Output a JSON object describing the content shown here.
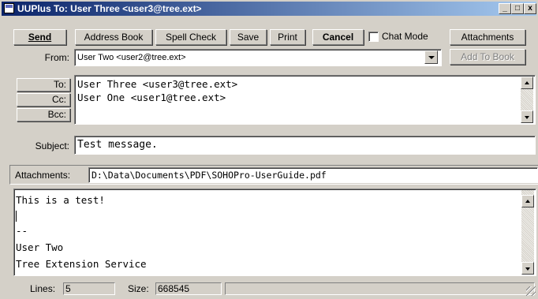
{
  "window": {
    "title": "UUPlus To: User Three <user3@tree.ext>",
    "controls": {
      "minimize": "_",
      "maximize": "□",
      "close": "x"
    }
  },
  "toolbar": {
    "send_label": "Send",
    "address_book_label": "Address Book",
    "spell_check_label": "Spell Check",
    "save_label": "Save",
    "print_label": "Print",
    "cancel_label": "Cancel",
    "chat_mode_label": "Chat Mode",
    "chat_mode_checked": false,
    "attachments_label": "Attachments"
  },
  "from": {
    "label": "From:",
    "value": "User Two <user2@tree.ext>",
    "add_to_book_label": "Add To Book"
  },
  "recipients": {
    "to_label": "To:",
    "cc_label": "Cc:",
    "bcc_label": "Bcc:",
    "lines": [
      "User Three <user3@tree.ext>",
      "User One <user1@tree.ext>"
    ]
  },
  "subject": {
    "label": "Subject:",
    "value": "Test message."
  },
  "attachments": {
    "label": "Attachments:",
    "value": "D:\\Data\\Documents\\PDF\\SOHOPro-UserGuide.pdf"
  },
  "body": {
    "lines": [
      "This is a test!",
      "",
      "--",
      "User Two",
      "Tree Extension Service"
    ]
  },
  "statusbar": {
    "lines_label": "Lines:",
    "lines_value": "5",
    "size_label": "Size:",
    "size_value": "668545"
  }
}
